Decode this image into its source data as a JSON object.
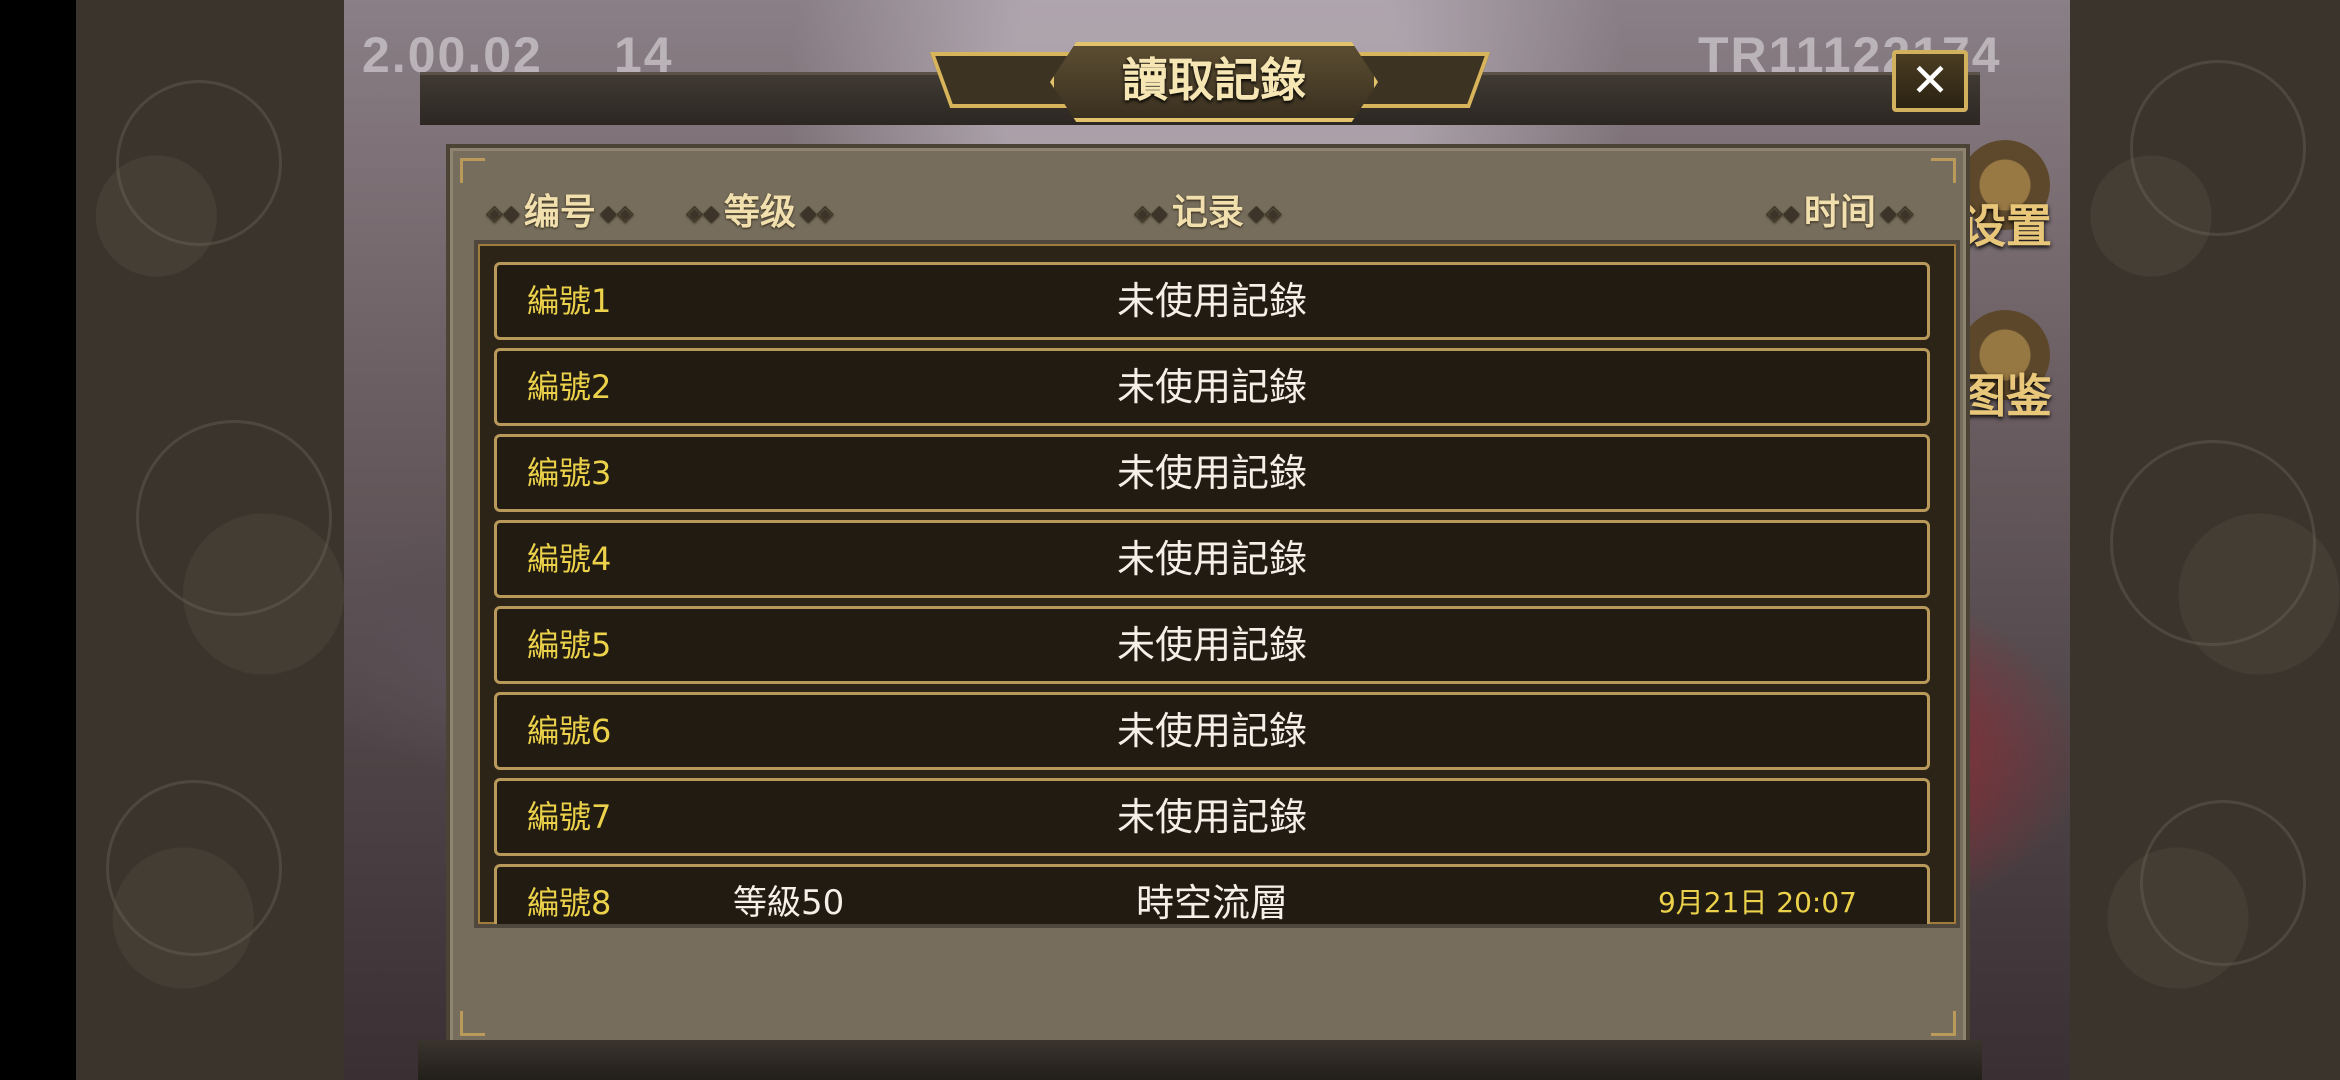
{
  "hud": {
    "version": "2.00.02",
    "value": "14",
    "player_id": "TR11122174"
  },
  "side_buttons": {
    "settings_label": "设置",
    "codex_label": "图鉴"
  },
  "dialog": {
    "title": "讀取記錄",
    "close_symbol": "✕"
  },
  "headers": {
    "number": "编号",
    "level": "等级",
    "record": "记录",
    "time": "时间"
  },
  "rows": [
    {
      "number": "編號1",
      "record": "未使用記錄"
    },
    {
      "number": "編號2",
      "record": "未使用記錄"
    },
    {
      "number": "編號3",
      "record": "未使用記錄"
    },
    {
      "number": "編號4",
      "record": "未使用記錄"
    },
    {
      "number": "編號5",
      "record": "未使用記錄"
    },
    {
      "number": "編號6",
      "record": "未使用記錄"
    },
    {
      "number": "編號7",
      "record": "未使用記錄"
    },
    {
      "number": "編號8",
      "level": "等級50",
      "record": "時空流層",
      "time": "9月21日 20:07"
    }
  ],
  "colors": {
    "number_text": "#ecd24a",
    "record_text": "#f4f0e8",
    "row_border": "#b8995a",
    "panel_bg": "#766d5c"
  }
}
